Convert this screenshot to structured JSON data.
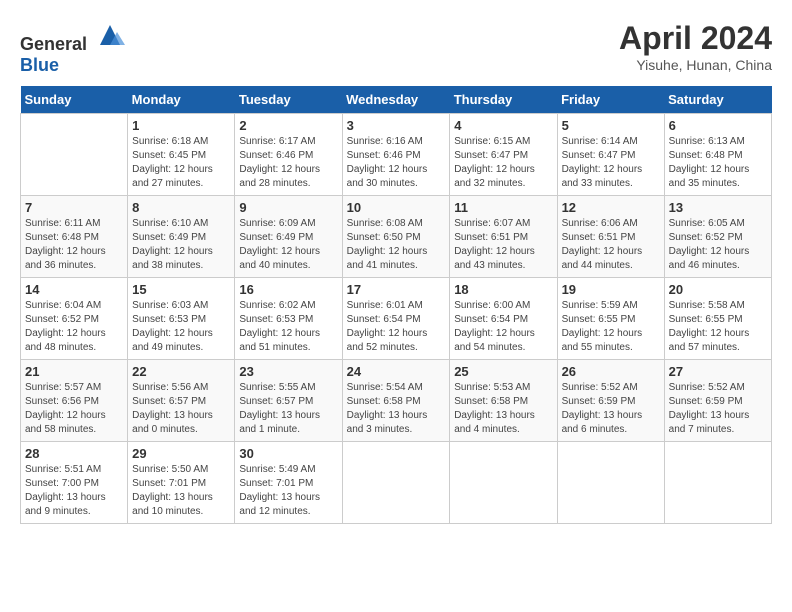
{
  "header": {
    "logo_general": "General",
    "logo_blue": "Blue",
    "month_year": "April 2024",
    "location": "Yisuhe, Hunan, China"
  },
  "days_of_week": [
    "Sunday",
    "Monday",
    "Tuesday",
    "Wednesday",
    "Thursday",
    "Friday",
    "Saturday"
  ],
  "weeks": [
    [
      {
        "day": "",
        "info": ""
      },
      {
        "day": "1",
        "info": "Sunrise: 6:18 AM\nSunset: 6:45 PM\nDaylight: 12 hours\nand 27 minutes."
      },
      {
        "day": "2",
        "info": "Sunrise: 6:17 AM\nSunset: 6:46 PM\nDaylight: 12 hours\nand 28 minutes."
      },
      {
        "day": "3",
        "info": "Sunrise: 6:16 AM\nSunset: 6:46 PM\nDaylight: 12 hours\nand 30 minutes."
      },
      {
        "day": "4",
        "info": "Sunrise: 6:15 AM\nSunset: 6:47 PM\nDaylight: 12 hours\nand 32 minutes."
      },
      {
        "day": "5",
        "info": "Sunrise: 6:14 AM\nSunset: 6:47 PM\nDaylight: 12 hours\nand 33 minutes."
      },
      {
        "day": "6",
        "info": "Sunrise: 6:13 AM\nSunset: 6:48 PM\nDaylight: 12 hours\nand 35 minutes."
      }
    ],
    [
      {
        "day": "7",
        "info": "Sunrise: 6:11 AM\nSunset: 6:48 PM\nDaylight: 12 hours\nand 36 minutes."
      },
      {
        "day": "8",
        "info": "Sunrise: 6:10 AM\nSunset: 6:49 PM\nDaylight: 12 hours\nand 38 minutes."
      },
      {
        "day": "9",
        "info": "Sunrise: 6:09 AM\nSunset: 6:49 PM\nDaylight: 12 hours\nand 40 minutes."
      },
      {
        "day": "10",
        "info": "Sunrise: 6:08 AM\nSunset: 6:50 PM\nDaylight: 12 hours\nand 41 minutes."
      },
      {
        "day": "11",
        "info": "Sunrise: 6:07 AM\nSunset: 6:51 PM\nDaylight: 12 hours\nand 43 minutes."
      },
      {
        "day": "12",
        "info": "Sunrise: 6:06 AM\nSunset: 6:51 PM\nDaylight: 12 hours\nand 44 minutes."
      },
      {
        "day": "13",
        "info": "Sunrise: 6:05 AM\nSunset: 6:52 PM\nDaylight: 12 hours\nand 46 minutes."
      }
    ],
    [
      {
        "day": "14",
        "info": "Sunrise: 6:04 AM\nSunset: 6:52 PM\nDaylight: 12 hours\nand 48 minutes."
      },
      {
        "day": "15",
        "info": "Sunrise: 6:03 AM\nSunset: 6:53 PM\nDaylight: 12 hours\nand 49 minutes."
      },
      {
        "day": "16",
        "info": "Sunrise: 6:02 AM\nSunset: 6:53 PM\nDaylight: 12 hours\nand 51 minutes."
      },
      {
        "day": "17",
        "info": "Sunrise: 6:01 AM\nSunset: 6:54 PM\nDaylight: 12 hours\nand 52 minutes."
      },
      {
        "day": "18",
        "info": "Sunrise: 6:00 AM\nSunset: 6:54 PM\nDaylight: 12 hours\nand 54 minutes."
      },
      {
        "day": "19",
        "info": "Sunrise: 5:59 AM\nSunset: 6:55 PM\nDaylight: 12 hours\nand 55 minutes."
      },
      {
        "day": "20",
        "info": "Sunrise: 5:58 AM\nSunset: 6:55 PM\nDaylight: 12 hours\nand 57 minutes."
      }
    ],
    [
      {
        "day": "21",
        "info": "Sunrise: 5:57 AM\nSunset: 6:56 PM\nDaylight: 12 hours\nand 58 minutes."
      },
      {
        "day": "22",
        "info": "Sunrise: 5:56 AM\nSunset: 6:57 PM\nDaylight: 13 hours\nand 0 minutes."
      },
      {
        "day": "23",
        "info": "Sunrise: 5:55 AM\nSunset: 6:57 PM\nDaylight: 13 hours\nand 1 minute."
      },
      {
        "day": "24",
        "info": "Sunrise: 5:54 AM\nSunset: 6:58 PM\nDaylight: 13 hours\nand 3 minutes."
      },
      {
        "day": "25",
        "info": "Sunrise: 5:53 AM\nSunset: 6:58 PM\nDaylight: 13 hours\nand 4 minutes."
      },
      {
        "day": "26",
        "info": "Sunrise: 5:52 AM\nSunset: 6:59 PM\nDaylight: 13 hours\nand 6 minutes."
      },
      {
        "day": "27",
        "info": "Sunrise: 5:52 AM\nSunset: 6:59 PM\nDaylight: 13 hours\nand 7 minutes."
      }
    ],
    [
      {
        "day": "28",
        "info": "Sunrise: 5:51 AM\nSunset: 7:00 PM\nDaylight: 13 hours\nand 9 minutes."
      },
      {
        "day": "29",
        "info": "Sunrise: 5:50 AM\nSunset: 7:01 PM\nDaylight: 13 hours\nand 10 minutes."
      },
      {
        "day": "30",
        "info": "Sunrise: 5:49 AM\nSunset: 7:01 PM\nDaylight: 13 hours\nand 12 minutes."
      },
      {
        "day": "",
        "info": ""
      },
      {
        "day": "",
        "info": ""
      },
      {
        "day": "",
        "info": ""
      },
      {
        "day": "",
        "info": ""
      }
    ]
  ]
}
